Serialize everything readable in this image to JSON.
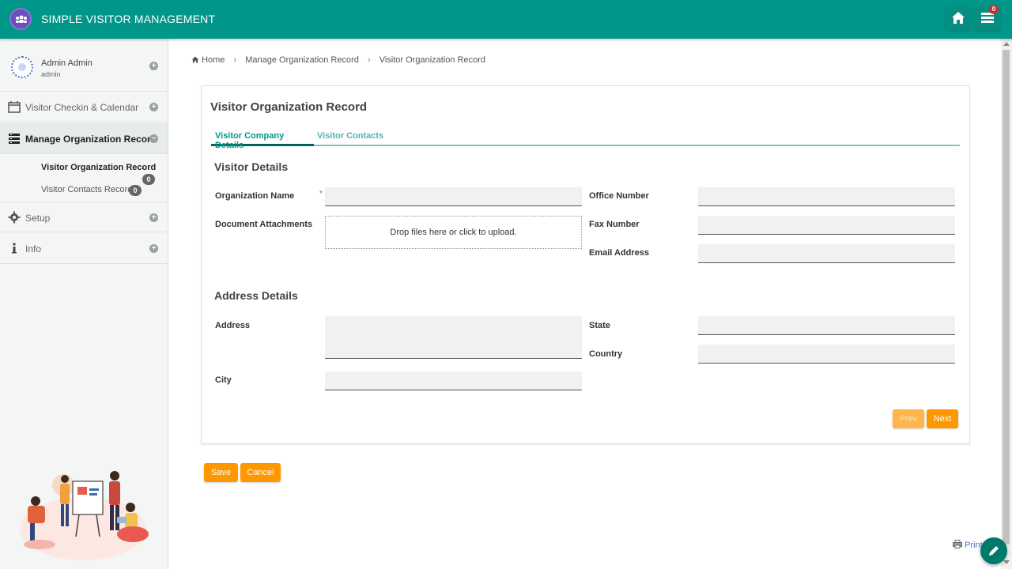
{
  "app": {
    "title": "SIMPLE VISITOR MANAGEMENT",
    "notifications_count": "0"
  },
  "user": {
    "name": "Admin Admin",
    "role": "admin"
  },
  "sidebar": {
    "items": [
      {
        "label": "Visitor Checkin & Calendar",
        "icon": "calendar-icon"
      },
      {
        "label": "Manage Organization Record",
        "icon": "list-icon"
      },
      {
        "label": "Setup",
        "icon": "gear-icon"
      },
      {
        "label": "Info",
        "icon": "info-icon"
      }
    ],
    "subitems": [
      {
        "label": "Visitor Organization Record",
        "count": "0"
      },
      {
        "label": "Visitor Contacts Record",
        "count": "0"
      }
    ]
  },
  "breadcrumb": [
    "Home",
    "Manage Organization Record",
    "Visitor Organization Record"
  ],
  "panel": {
    "title": "Visitor Organization Record",
    "tabs": [
      "Visitor Company Details",
      "Visitor Contacts"
    ],
    "visitor_details": {
      "title": "Visitor Details",
      "organization_name": "Organization Name",
      "required_mark": "*",
      "document_attachments": "Document Attachments",
      "dropzone_text": "Drop files here or click to upload.",
      "office_number": "Office Number",
      "fax_number": "Fax Number",
      "email_address": "Email Address"
    },
    "address_details": {
      "title": "Address Details",
      "address": "Address",
      "city": "City",
      "state": "State",
      "country": "Country"
    },
    "prev_label": "Prev",
    "next_label": "Next"
  },
  "actions": {
    "save_label": "Save",
    "cancel_label": "Cancel"
  },
  "print_label": "Print",
  "colors": {
    "header": "#00968a",
    "accent": "#ff9800",
    "tab_active": "#00645b"
  }
}
